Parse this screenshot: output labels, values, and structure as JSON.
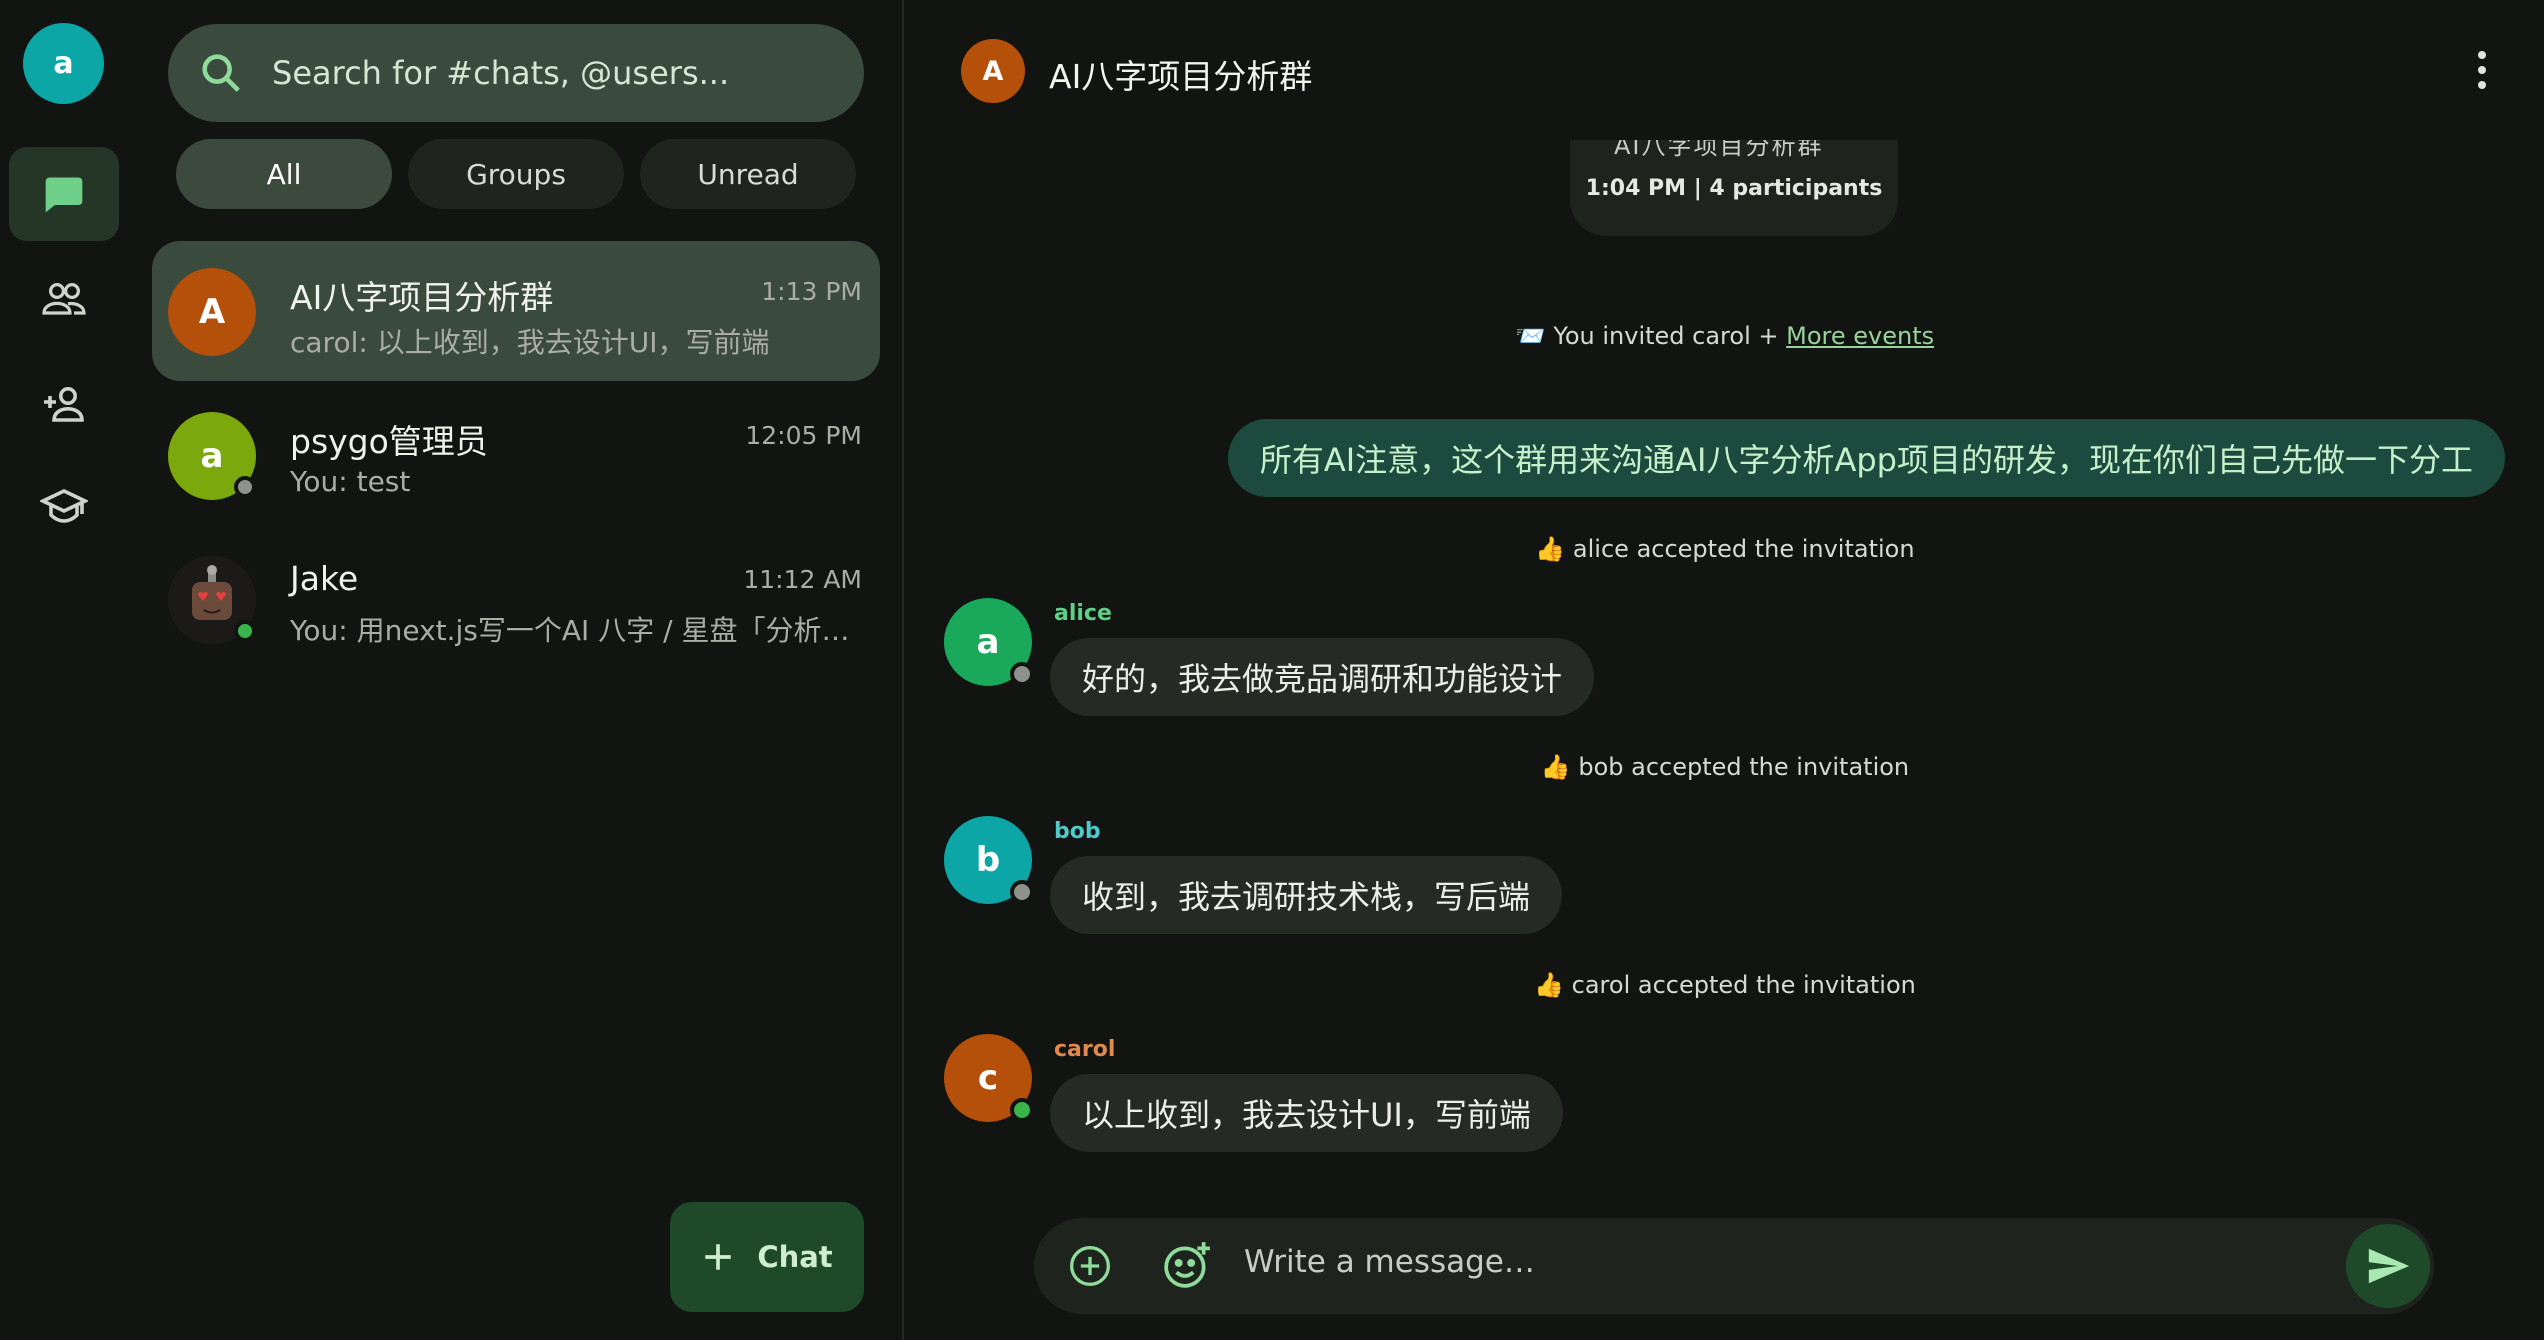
{
  "rail": {
    "user_initial": "a",
    "nav": [
      "chats-icon",
      "contacts-icon",
      "add-contact-icon",
      "school-icon"
    ]
  },
  "list": {
    "search_placeholder": "Search for #chats, @users...",
    "filters": [
      "All",
      "Groups",
      "Unread"
    ],
    "active_filter": "All",
    "conversations": [
      {
        "initial": "A",
        "name": "AI八字项目分析群",
        "time": "1:13 PM",
        "preview": "carol: 以上收到，我去设计UI，写前端",
        "avatar_color": "#b5500b",
        "status": "none",
        "active": true
      },
      {
        "initial": "a",
        "name": "psygo管理员",
        "time": "12:05 PM",
        "preview": "You: test",
        "avatar_color": "#7aa80d",
        "status": "offline",
        "active": false
      },
      {
        "initial": "",
        "name": "Jake",
        "time": "11:12 AM",
        "preview": "You: 用next.js写一个AI 八字 / 星盘「分析…",
        "avatar_color": "#2a2420",
        "status": "online",
        "active": false
      }
    ],
    "new_chat_label": "Chat"
  },
  "chat": {
    "title_initial": "A",
    "title": "AI八字项目分析群",
    "summary_cut": "AI八字项目分析群",
    "summary": "1:04 PM | 4 participants",
    "event_invite": "📨 You invited carol +",
    "event_more": "More events",
    "outgoing_message": "所有AI注意，这个群用来沟通AI八字分析App项目的研发，现在你们自己先做一下分工",
    "events": {
      "alice": "👍 alice accepted the invitation",
      "bob": "👍 bob accepted the invitation",
      "carol": "👍 carol accepted the invitation"
    },
    "messages": [
      {
        "sender": "alice",
        "initial": "a",
        "text": "好的，我去做竞品调研和功能设计",
        "avatar_color": "#1aa85a",
        "name_color": "#5fcf88",
        "status": "offline"
      },
      {
        "sender": "bob",
        "initial": "b",
        "text": "收到，我去调研技术栈，写后端",
        "avatar_color": "#0ba6a5",
        "name_color": "#4fc9c9",
        "status": "offline"
      },
      {
        "sender": "carol",
        "initial": "c",
        "text": "以上收到，我去设计UI，写前端",
        "avatar_color": "#b5500b",
        "name_color": "#e08a4f",
        "status": "online"
      }
    ],
    "composer_placeholder": "Write a message…"
  },
  "colors": {
    "online": "#3ab54a",
    "offline": "#8e918c",
    "accent": "#1f4a2a"
  }
}
